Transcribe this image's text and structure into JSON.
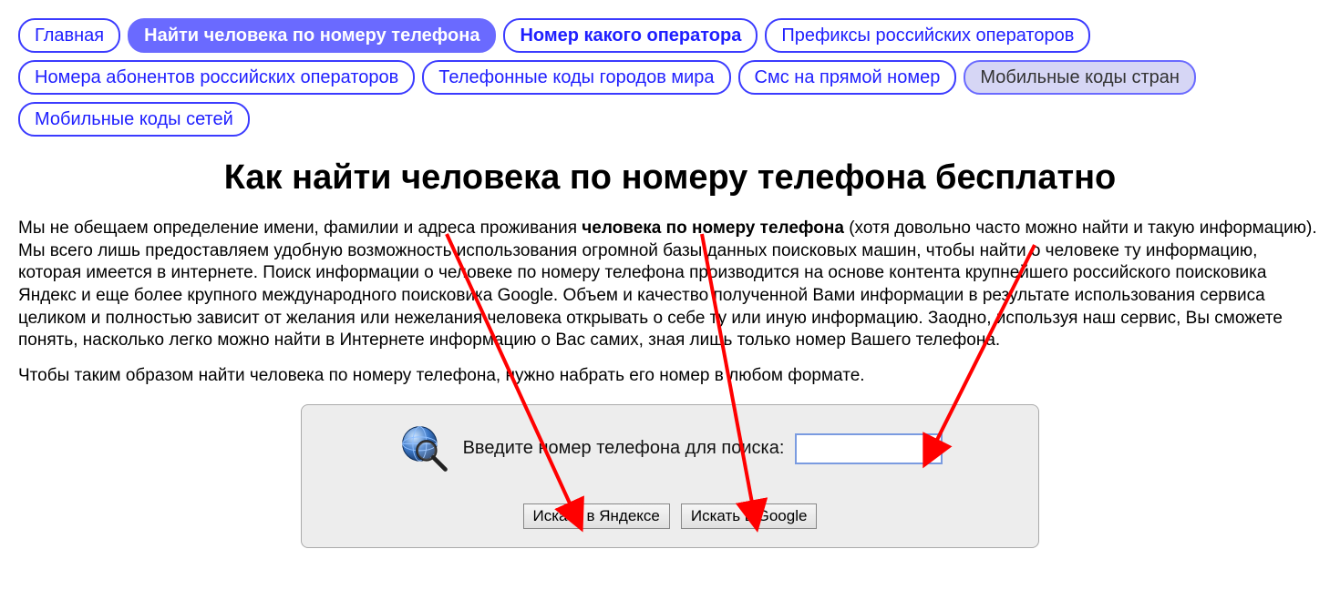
{
  "nav": {
    "items": [
      {
        "label": "Главная",
        "variant": "plain"
      },
      {
        "label": "Найти человека по номеру телефона",
        "variant": "active"
      },
      {
        "label": "Номер какого оператора",
        "variant": "bold"
      },
      {
        "label": "Префиксы российских операторов",
        "variant": "plain"
      },
      {
        "label": "Номера абонентов российских операторов",
        "variant": "plain"
      },
      {
        "label": "Телефонные коды городов мира",
        "variant": "plain"
      },
      {
        "label": "Смс на прямой номер",
        "variant": "plain"
      },
      {
        "label": "Мобильные коды стран",
        "variant": "muted"
      },
      {
        "label": "Мобильные коды сетей",
        "variant": "plain"
      }
    ]
  },
  "headline": "Как найти человека по номеру телефона бесплатно",
  "paragraphs": {
    "p1_before": "Мы не обещаем определение имени, фамилии и адреса проживания ",
    "p1_bold": "человека по номеру телефона",
    "p1_after": " (хотя довольно часто можно найти и такую информацию). Мы всего лишь предоставляем удобную возможность использования огромной базы данных поисковых машин, чтобы найти о человеке ту информацию, которая имеется в интернете. Поиск информации о человеке по номеру телефона производится на основе контента крупнейшего российского поисковика Яндекс и еще более крупного международного поисковика Google. Объем и качество полученной Вами информации в результате использования сервиса целиком и полностью зависит от желания или нежелания человека открывать о себе ту или иную информацию. Заодно, используя наш сервис, Вы сможете понять, насколько легко можно найти в Интернете информацию о Вас самих, зная лишь только номер Вашего телефона.",
    "p2": "Чтобы таким образом найти человека по номеру телефона, нужно набрать его номер в любом формате."
  },
  "search": {
    "label": "Введите номер телефона для поиска:",
    "value": "",
    "yandex_btn": "Искать в Яндексе",
    "google_btn": "Искать в Google"
  }
}
